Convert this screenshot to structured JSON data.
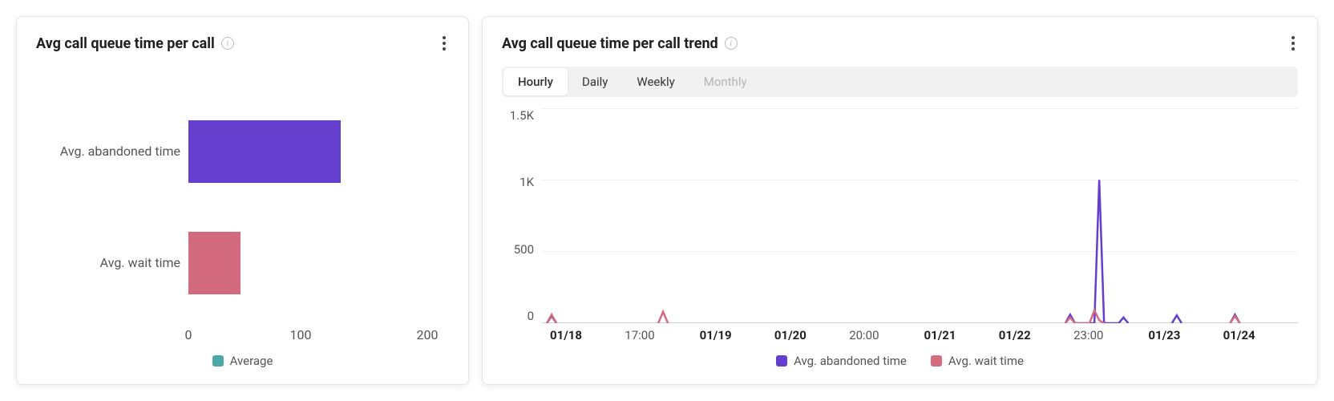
{
  "colors": {
    "purple": "#643ECC",
    "pink": "#D46A7E",
    "teal": "#4BA8A8"
  },
  "card1": {
    "title": "Avg call queue time per call",
    "legend_label": "Average",
    "axis_ticks": [
      "0",
      "100",
      "200"
    ]
  },
  "card2": {
    "title": "Avg call queue time per call trend",
    "segments": {
      "hourly": "Hourly",
      "daily": "Daily",
      "weekly": "Weekly",
      "monthly": "Monthly"
    },
    "y_ticks": [
      "1.5K",
      "1K",
      "500",
      "0"
    ],
    "x_ticks": [
      "01/18",
      "17:00",
      "01/19",
      "01/20",
      "20:00",
      "01/21",
      "01/22",
      "23:00",
      "01/23",
      "01/24"
    ],
    "legend": {
      "a": "Avg. abandoned time",
      "b": "Avg. wait time"
    }
  },
  "chart_data": [
    {
      "type": "bar",
      "orientation": "horizontal",
      "title": "Avg call queue time per call",
      "categories": [
        "Avg. abandoned time",
        "Avg. wait time"
      ],
      "series": [
        {
          "name": "Average",
          "values": [
            117,
            40
          ],
          "colors": [
            "#643ECC",
            "#D46A7E"
          ]
        }
      ],
      "xlim": [
        0,
        200
      ],
      "x_ticks": [
        0,
        100,
        200
      ]
    },
    {
      "type": "line",
      "title": "Avg call queue time per call trend",
      "granularity": "Hourly",
      "ylim": [
        0,
        1500
      ],
      "y_ticks": [
        0,
        500,
        1000,
        1500
      ],
      "x_range": [
        "01/18 00:00",
        "01/24 12:00"
      ],
      "series": [
        {
          "name": "Avg. abandoned time",
          "color": "#643ECC",
          "points": [
            {
              "t": "01/18 01:00",
              "v": 0
            },
            {
              "t": "01/18 02:00",
              "v": 50
            },
            {
              "t": "01/18 03:00",
              "v": 0
            },
            {
              "t": "01/22 12:00",
              "v": 0
            },
            {
              "t": "01/22 13:00",
              "v": 60
            },
            {
              "t": "01/22 14:00",
              "v": 0
            },
            {
              "t": "01/22 18:00",
              "v": 0
            },
            {
              "t": "01/22 19:00",
              "v": 1000
            },
            {
              "t": "01/22 20:00",
              "v": 0
            },
            {
              "t": "01/22 23:00",
              "v": 0
            },
            {
              "t": "01/23 00:00",
              "v": 40
            },
            {
              "t": "01/23 01:00",
              "v": 0
            },
            {
              "t": "01/23 10:00",
              "v": 0
            },
            {
              "t": "01/23 11:00",
              "v": 55
            },
            {
              "t": "01/23 12:00",
              "v": 0
            },
            {
              "t": "01/23 22:00",
              "v": 0
            },
            {
              "t": "01/23 23:00",
              "v": 60
            },
            {
              "t": "01/24 00:00",
              "v": 0
            }
          ]
        },
        {
          "name": "Avg. wait time",
          "color": "#D46A7E",
          "points": [
            {
              "t": "01/18 01:00",
              "v": 0
            },
            {
              "t": "01/18 02:00",
              "v": 60
            },
            {
              "t": "01/18 03:00",
              "v": 0
            },
            {
              "t": "01/19 00:00",
              "v": 0
            },
            {
              "t": "01/19 01:00",
              "v": 80
            },
            {
              "t": "01/19 02:00",
              "v": 0
            },
            {
              "t": "01/22 12:00",
              "v": 0
            },
            {
              "t": "01/22 13:00",
              "v": 40
            },
            {
              "t": "01/22 14:00",
              "v": 0
            },
            {
              "t": "01/22 17:00",
              "v": 0
            },
            {
              "t": "01/22 18:00",
              "v": 90
            },
            {
              "t": "01/22 19:00",
              "v": 20
            },
            {
              "t": "01/22 20:00",
              "v": 0
            },
            {
              "t": "01/23 22:00",
              "v": 0
            },
            {
              "t": "01/23 23:00",
              "v": 50
            },
            {
              "t": "01/24 00:00",
              "v": 0
            }
          ]
        }
      ]
    }
  ]
}
